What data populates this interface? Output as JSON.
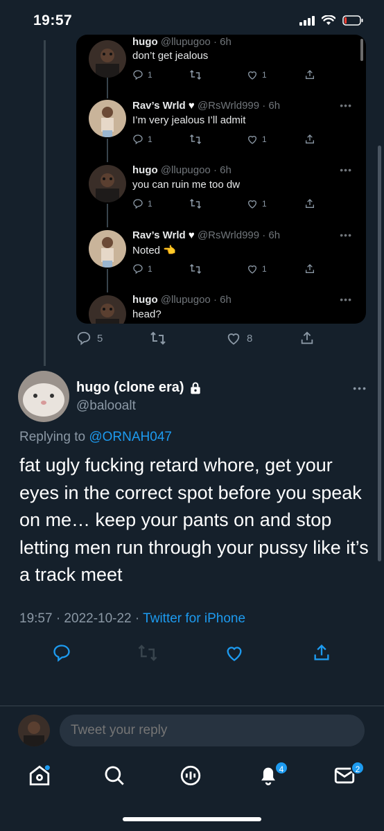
{
  "status_bar": {
    "time": "19:57"
  },
  "quoted_thread": [
    {
      "name": "hugo",
      "handle": "@llupugoo · 6h",
      "text": "don’t get jealous",
      "replies": "1",
      "likes": "1"
    },
    {
      "name": "Rav’s Wrld",
      "handle": "@RsWrld999 · 6h",
      "text": "I’m very jealous I’ll admit",
      "replies": "1",
      "likes": "1"
    },
    {
      "name": "hugo",
      "handle": "@llupugoo · 6h",
      "text": "you can ruin me too dw",
      "replies": "1",
      "likes": "1"
    },
    {
      "name": "Rav’s Wrld",
      "handle": "@RsWrld999 · 6h",
      "text": "Noted",
      "replies": "1",
      "likes": "1"
    },
    {
      "name": "hugo",
      "handle": "@llupugoo · 6h",
      "text": "head?"
    }
  ],
  "previous_tweet_actions": {
    "replies": "5",
    "likes": "8"
  },
  "tweet": {
    "author_name": "hugo (clone era)",
    "handle": "@balooalt",
    "replying_prefix": "Replying to",
    "replying_to": "@ORNAH047",
    "text": "fat ugly fucking retard whore, get your eyes in the correct spot before you speak on me… keep your pants on and stop letting men run through your pussy like it’s a track meet",
    "timestamp": "19:57 · 2022-10-22 · ",
    "source": "Twitter for iPhone"
  },
  "reply_bar": {
    "placeholder": "Tweet your reply"
  },
  "tab_bar": {
    "notifications_badge": "4",
    "messages_badge": "2"
  },
  "colors": {
    "background": "#15202b",
    "accent": "#1d9bf0",
    "muted": "#8b98a5",
    "card": "#000000"
  }
}
